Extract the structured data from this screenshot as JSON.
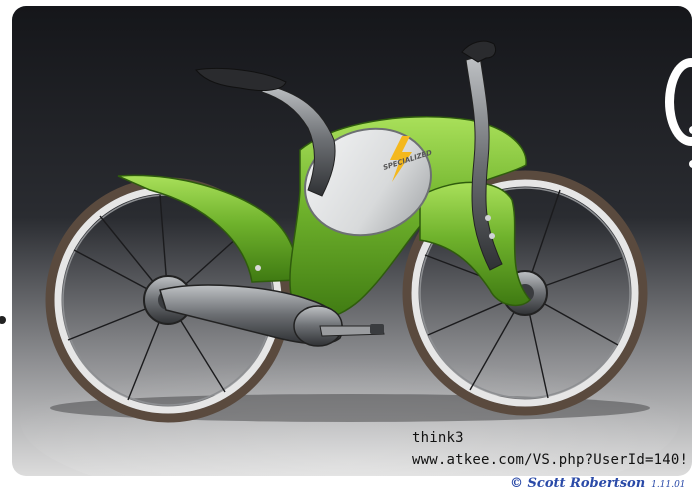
{
  "image": {
    "subject": "bicycle",
    "colors": {
      "frame_green": "#6fb22c",
      "frame_green_dark": "#3f7a12",
      "panel_silver": "#d8dadb",
      "backdrop_dark": "#16171a",
      "backdrop_light": "#d9d9d9",
      "tire": "#5a4a3e",
      "rim": "#e6e6e6"
    }
  },
  "watermark": {
    "line1": "think3",
    "line2": "www.atkee.com/VS.php?UserId=140!"
  },
  "signature": {
    "name": "© Scott Robertson",
    "year": "1.11.01"
  },
  "logo": {
    "text": "SPECIALIZED"
  }
}
